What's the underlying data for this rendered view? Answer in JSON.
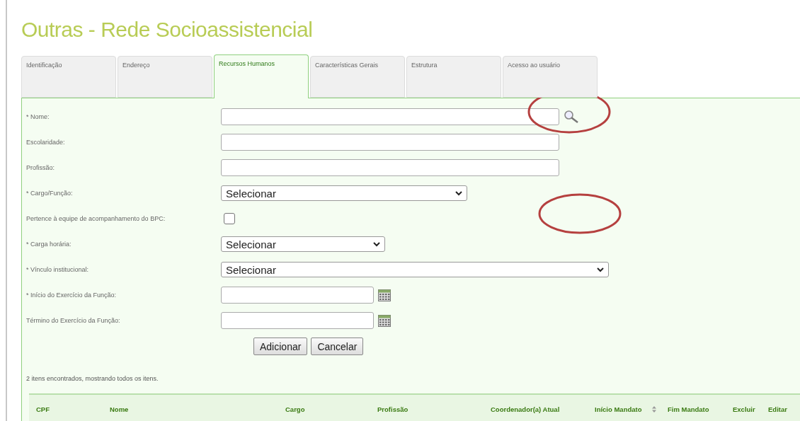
{
  "title": "Outras - Rede Socioassistencial",
  "tabs": [
    {
      "label": "Identificação",
      "selected": false
    },
    {
      "label": "Endereço",
      "selected": false
    },
    {
      "label": "Recursos Humanos",
      "selected": true
    },
    {
      "label": "Características Gerais",
      "selected": false
    },
    {
      "label": "Estrutura",
      "selected": false
    },
    {
      "label": "Acesso ao usuário",
      "selected": false
    }
  ],
  "fields": [
    {
      "label": "* Nome:",
      "kind": "search"
    },
    {
      "label": "Escolaridade:",
      "kind": "text"
    },
    {
      "label": "Profissão:",
      "kind": "text"
    },
    {
      "label": "* Cargo/Função:",
      "kind": "select",
      "value": "Selecionar"
    },
    {
      "label": "Pertence à equipe de acompanhamento do BPC:",
      "kind": "checkbox",
      "checked": false
    },
    {
      "label": "* Carga horária:",
      "kind": "select",
      "value": "Selecionar"
    },
    {
      "label": "* Vínculo institucional:",
      "kind": "select",
      "value": "Selecionar"
    },
    {
      "label": "* Início do Exercício da Função:",
      "kind": "date"
    },
    {
      "label": "Término do Exercício da Função:",
      "kind": "date"
    }
  ],
  "buttons": [
    "Adicionar",
    "Cancelar"
  ],
  "result_text": "2 itens encontrados, mostrando todos os itens.",
  "table": {
    "columns": [
      {
        "label": "CPF"
      },
      {
        "label": "Nome"
      },
      {
        "label": "Cargo"
      },
      {
        "label": "Profissão"
      },
      {
        "label": "Coordenador(a) Atual"
      },
      {
        "label": "Início Mandato",
        "sortable": true
      },
      {
        "label": "Fim Mandato"
      },
      {
        "label": "Excluir"
      },
      {
        "label": "Editar"
      }
    ]
  }
}
